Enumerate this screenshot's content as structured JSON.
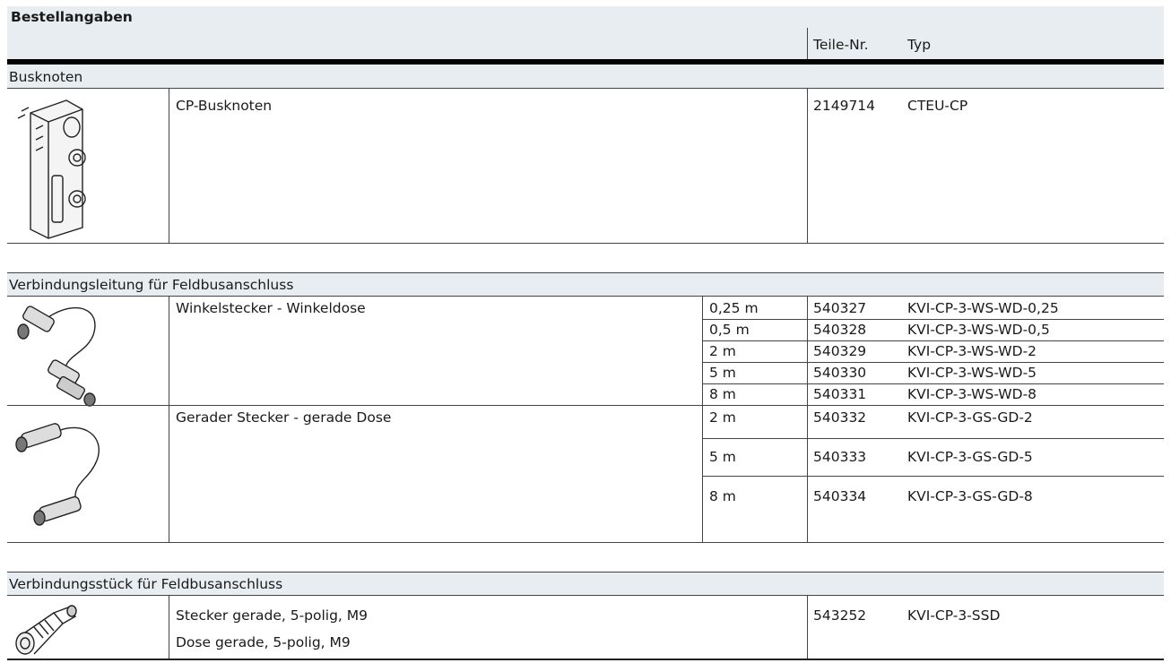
{
  "title": "Bestellangaben",
  "columns": {
    "part_no": "Teile-Nr.",
    "type": "Typ"
  },
  "sections": [
    {
      "heading": "Busknoten",
      "groups": [
        {
          "image": "bus-node-device-image",
          "descriptions": [
            "CP-Busknoten"
          ],
          "rows": [
            {
              "length": "",
              "part_no": "2149714",
              "type": "CTEU-CP"
            }
          ]
        }
      ]
    },
    {
      "heading": "Verbindungsleitung für Feldbusanschluss",
      "groups": [
        {
          "image": "angled-cable-image",
          "descriptions": [
            "Winkelstecker - Winkeldose"
          ],
          "rows": [
            {
              "length": "0,25 m",
              "part_no": "540327",
              "type": "KVI-CP-3-WS-WD-0,25"
            },
            {
              "length": "0,5 m",
              "part_no": "540328",
              "type": "KVI-CP-3-WS-WD-0,5"
            },
            {
              "length": "2 m",
              "part_no": "540329",
              "type": "KVI-CP-3-WS-WD-2"
            },
            {
              "length": "5 m",
              "part_no": "540330",
              "type": "KVI-CP-3-WS-WD-5"
            },
            {
              "length": "8 m",
              "part_no": "540331",
              "type": "KVI-CP-3-WS-WD-8"
            }
          ]
        },
        {
          "image": "straight-cable-image",
          "descriptions": [
            "Gerader Stecker - gerade Dose"
          ],
          "rows": [
            {
              "length": "2 m",
              "part_no": "540332",
              "type": "KVI-CP-3-GS-GD-2"
            },
            {
              "length": "5 m",
              "part_no": "540333",
              "type": "KVI-CP-3-GS-GD-5"
            },
            {
              "length": "8 m",
              "part_no": "540334",
              "type": "KVI-CP-3-GS-GD-8"
            }
          ]
        }
      ]
    },
    {
      "heading": "Verbindungsstück für Feldbusanschluss",
      "groups": [
        {
          "image": "connector-fitting-image",
          "descriptions": [
            "Stecker gerade, 5-polig, M9",
            "Dose gerade, 5-polig, M9"
          ],
          "rows": [
            {
              "length": "",
              "part_no": "543252",
              "type": "KVI-CP-3-SSD"
            }
          ]
        }
      ]
    }
  ]
}
